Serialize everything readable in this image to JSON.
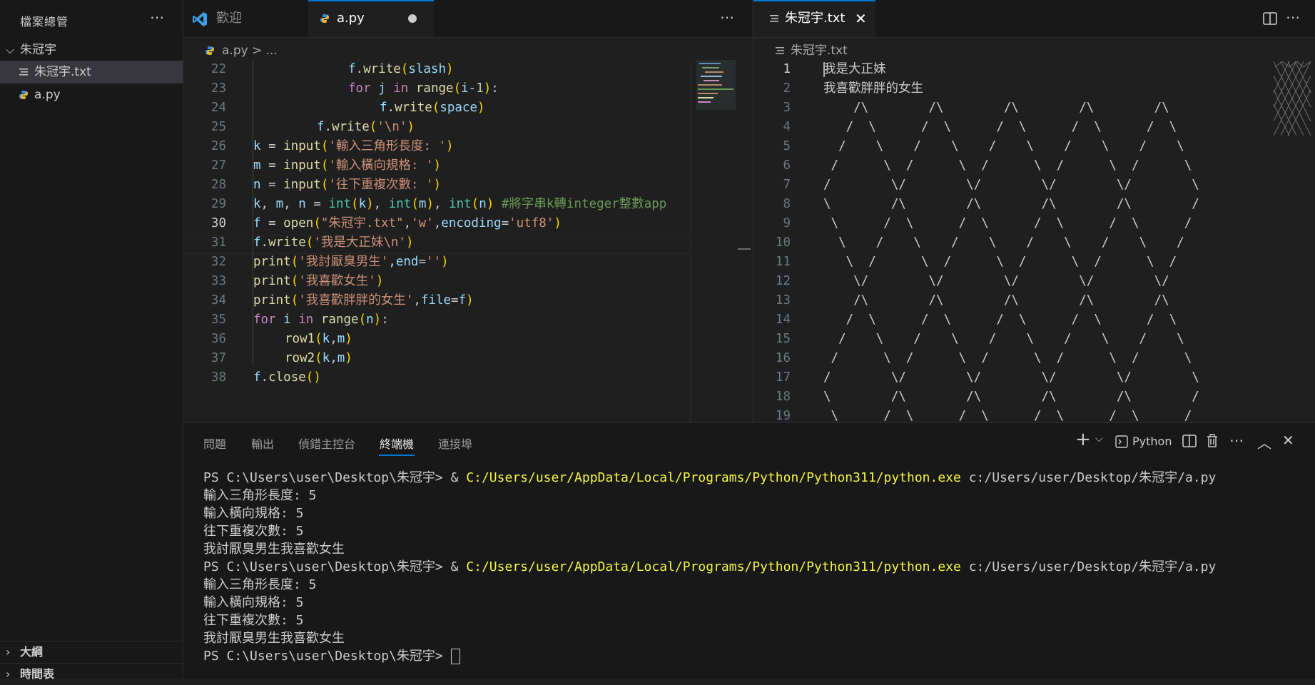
{
  "sidebar": {
    "title": "檔案總管",
    "folder": "朱冠宇",
    "files": [
      "朱冠宇.txt",
      "a.py"
    ],
    "sections": [
      "大綱",
      "時間表"
    ]
  },
  "editor_left": {
    "tabs": [
      "歡迎",
      "a.py"
    ],
    "breadcrumb_file": "a.py",
    "breadcrumb_rest": "> ...",
    "current_line": 30
  },
  "editor_right": {
    "tab": "朱冠宇.txt",
    "breadcrumb_file": "朱冠宇.txt",
    "lines": [
      "我是大正妹",
      "我喜歡胖胖的女生",
      "    /\\        /\\        /\\        /\\        /\\",
      "   /  \\      /  \\      /  \\      /  \\      /  \\",
      "  /    \\    /    \\    /    \\    /    \\    /    \\",
      " /      \\  /      \\  /      \\  /      \\  /      \\",
      "/        \\/        \\/        \\/        \\/        \\",
      "\\        /\\        /\\        /\\        /\\        /",
      " \\      /  \\      /  \\      /  \\      /  \\      /",
      "  \\    /    \\    /    \\    /    \\    /    \\    /",
      "   \\  /      \\  /      \\  /      \\  /      \\  /",
      "    \\/        \\/        \\/        \\/        \\/",
      "    /\\        /\\        /\\        /\\        /\\",
      "   /  \\      /  \\      /  \\      /  \\      /  \\",
      "  /    \\    /    \\    /    \\    /    \\    /    \\",
      " /      \\  /      \\  /      \\  /      \\  /      \\",
      "/        \\/        \\/        \\/        \\/        \\",
      "\\        /\\        /\\        /\\        /\\        /",
      " \\      /  \\      /  \\      /  \\      /  \\      /"
    ]
  },
  "panel": {
    "tabs": [
      "問題",
      "輸出",
      "偵錯主控台",
      "終端機",
      "連接埠"
    ],
    "active_tab": "終端機",
    "shell_label": "Python",
    "terminal": {
      "prompt": "PS C:\\Users\\user\\Desktop\\朱冠宇> ",
      "amp": "& ",
      "exe": "C:/Users/user/AppData/Local/Programs/Python/Python311/python.exe",
      "script": " c:/Users/user/Desktop/朱冠宇/a.py",
      "out1": "輸入三角形長度: 5",
      "out2": "輸入橫向規格: 5",
      "out3": "往下重複次數: 5",
      "out4": "我討厭臭男生我喜歡女生",
      "final_prompt": "PS C:\\Users\\user\\Desktop\\朱冠宇> "
    }
  },
  "colors": {
    "accent": "#0078d4",
    "terminal_exe": "#f5f543"
  }
}
